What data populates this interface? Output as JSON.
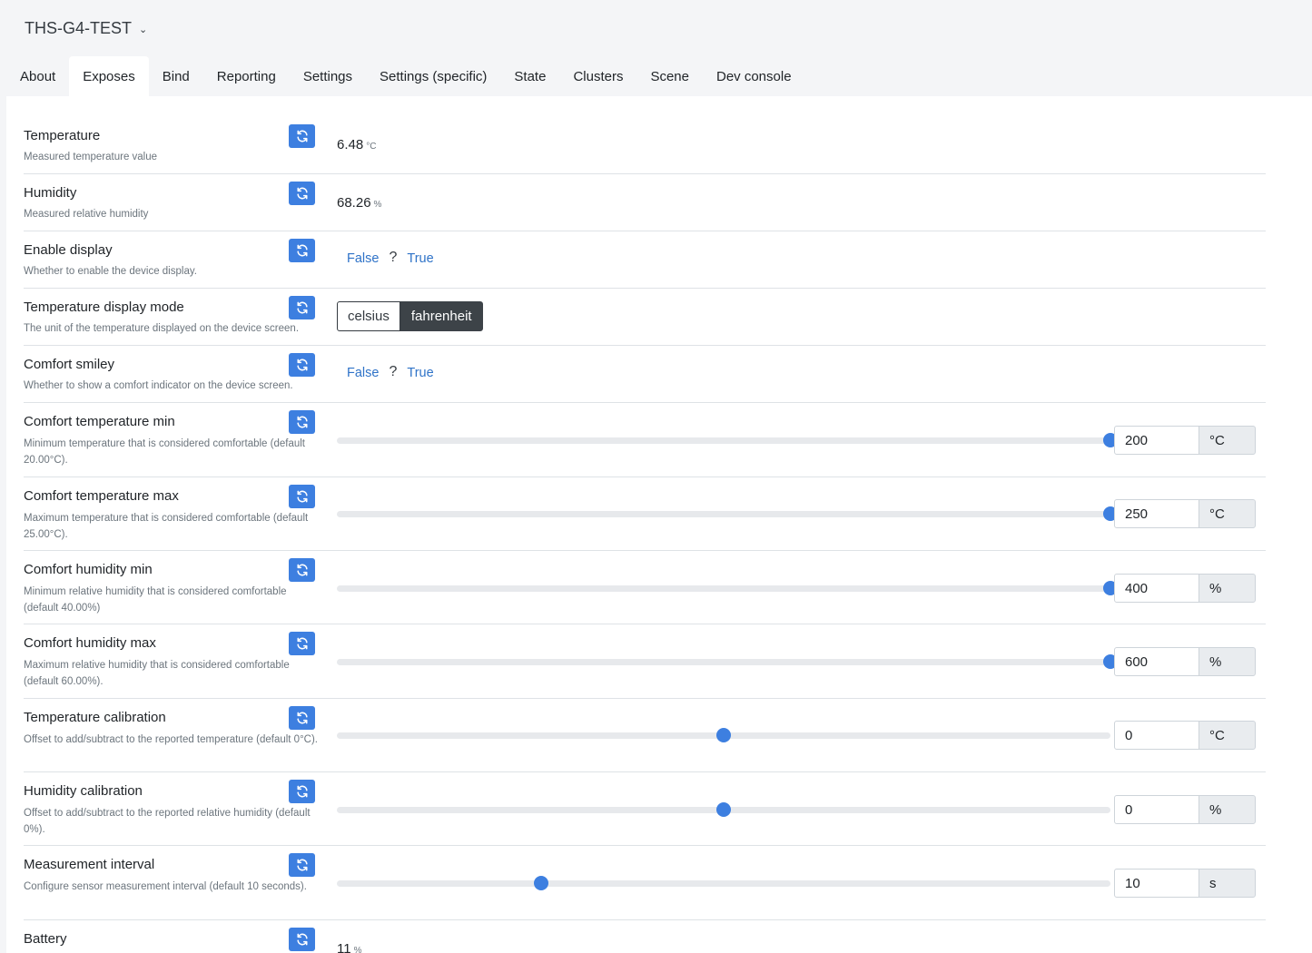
{
  "device": {
    "title": "THS-G4-TEST"
  },
  "tabs": [
    "About",
    "Exposes",
    "Bind",
    "Reporting",
    "Settings",
    "Settings (specific)",
    "State",
    "Clusters",
    "Scene",
    "Dev console"
  ],
  "exposes": {
    "temperature": {
      "label": "Temperature",
      "description": "Measured temperature value",
      "value": "6.48",
      "unit": "°C"
    },
    "humidity": {
      "label": "Humidity",
      "description": "Measured relative humidity",
      "value": "68.26",
      "unit": "%"
    },
    "enable_display": {
      "label": "Enable display",
      "description": "Whether to enable the device display.",
      "false_label": "False",
      "unknown": "?",
      "true_label": "True"
    },
    "temperature_display_mode": {
      "label": "Temperature display mode",
      "description": "The unit of the temperature displayed on the device screen.",
      "options": [
        "celsius",
        "fahrenheit"
      ],
      "selected": "fahrenheit"
    },
    "comfort_smiley": {
      "label": "Comfort smiley",
      "description": "Whether to show a comfort indicator on the device screen.",
      "false_label": "False",
      "unknown": "?",
      "true_label": "True"
    },
    "comfort_temperature_min": {
      "label": "Comfort temperature min",
      "description": "Minimum temperature that is considered comfortable (default 20.00°C).",
      "value": "200",
      "unit": "°C",
      "slider_fraction": 1.0
    },
    "comfort_temperature_max": {
      "label": "Comfort temperature max",
      "description": "Maximum temperature that is considered comfortable (default 25.00°C).",
      "value": "250",
      "unit": "°C",
      "slider_fraction": 1.0
    },
    "comfort_humidity_min": {
      "label": "Comfort humidity min",
      "description": "Minimum relative humidity that is considered comfortable (default 40.00%)",
      "value": "400",
      "unit": "%",
      "slider_fraction": 1.0
    },
    "comfort_humidity_max": {
      "label": "Comfort humidity max",
      "description": "Maximum relative humidity that is considered comfortable (default 60.00%).",
      "value": "600",
      "unit": "%",
      "slider_fraction": 1.0
    },
    "temperature_calibration": {
      "label": "Temperature calibration",
      "description": "Offset to add/subtract to the reported temperature (default 0°C).",
      "value": "0",
      "unit": "°C",
      "slider_fraction": 0.5
    },
    "humidity_calibration": {
      "label": "Humidity calibration",
      "description": "Offset to add/subtract to the reported relative humidity (default 0%).",
      "value": "0",
      "unit": "%",
      "slider_fraction": 0.5
    },
    "measurement_interval": {
      "label": "Measurement interval",
      "description": "Configure sensor measurement interval (default 10 seconds).",
      "value": "10",
      "unit": "s",
      "slider_fraction": 0.264
    },
    "battery": {
      "label": "Battery",
      "value": "11",
      "unit": "%"
    }
  },
  "colors": {
    "accent": "#3d7fe0",
    "link": "#2f73c8",
    "toggle_active": "#3d4348"
  },
  "icons": {
    "refresh": "refresh-icon",
    "dropdown": "chevron-down-icon"
  }
}
